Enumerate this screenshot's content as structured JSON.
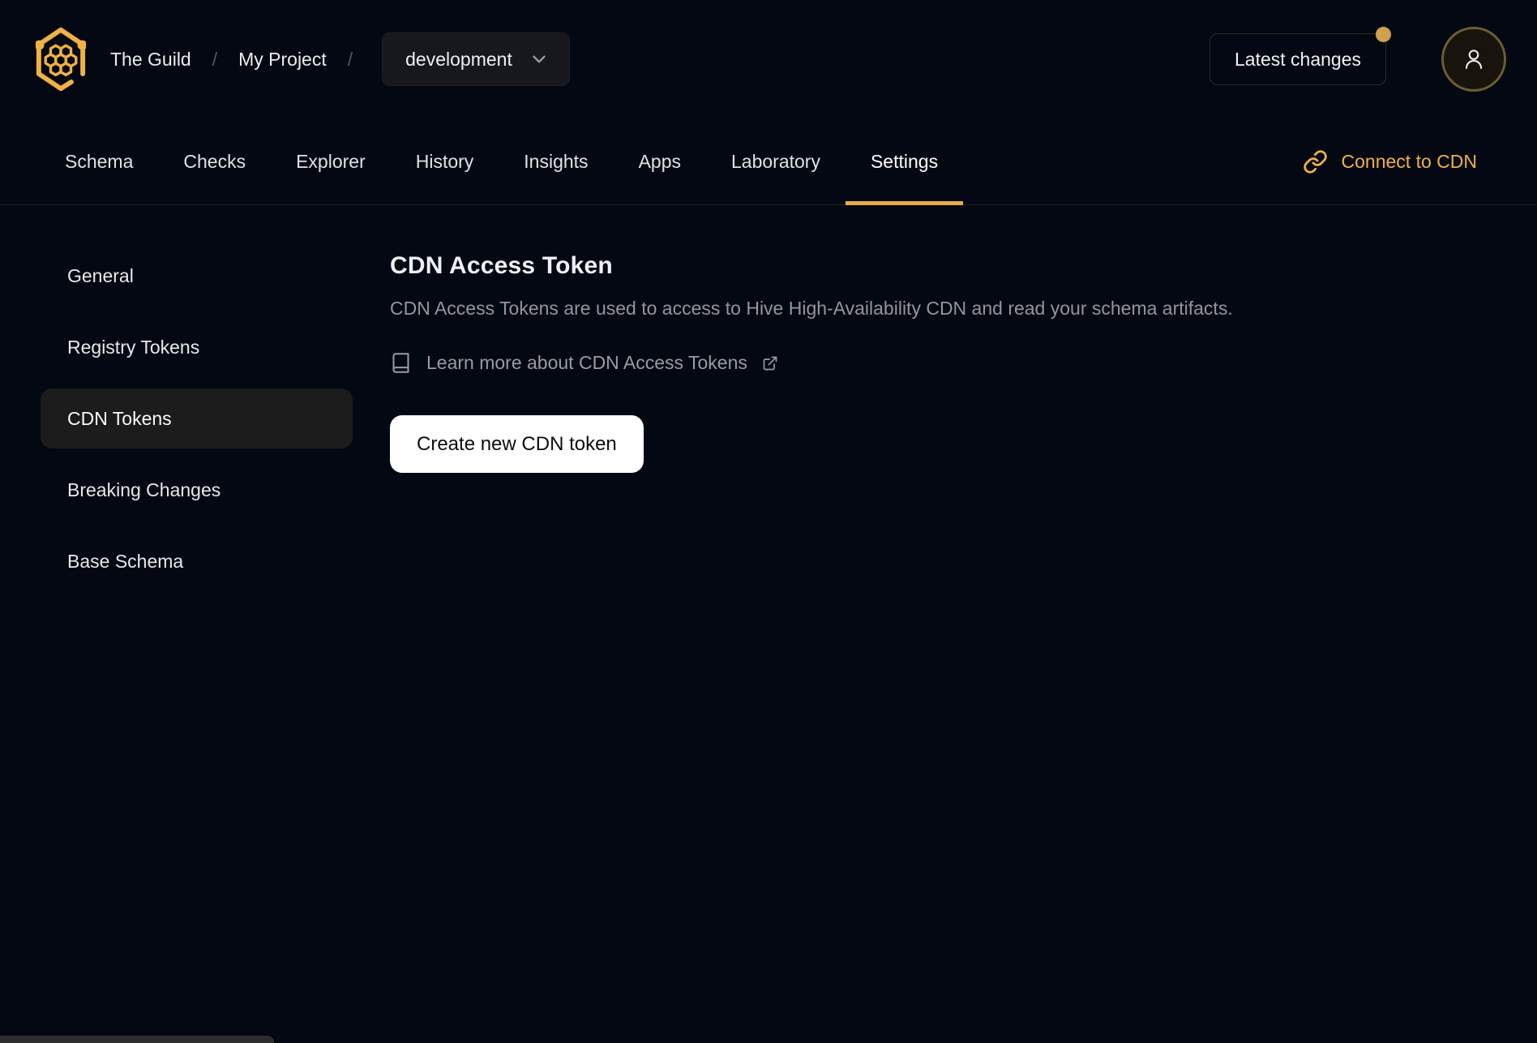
{
  "header": {
    "organization": "The Guild",
    "separator": "/",
    "project": "My Project",
    "target": "development",
    "latest_changes": "Latest changes",
    "notification_dot": true
  },
  "nav": {
    "tabs": [
      "Schema",
      "Checks",
      "Explorer",
      "History",
      "Insights",
      "Apps",
      "Laboratory",
      "Settings"
    ],
    "active_tab": "Settings",
    "connect_cdn": "Connect to CDN"
  },
  "sidebar": {
    "items": [
      "General",
      "Registry Tokens",
      "CDN Tokens",
      "Breaking Changes",
      "Base Schema"
    ],
    "active_item": "CDN Tokens"
  },
  "main": {
    "title": "CDN Access Token",
    "description": "CDN Access Tokens are used to access to Hive High-Availability CDN and read your schema artifacts.",
    "learn_more": "Learn more about CDN Access Tokens",
    "create_button": "Create new CDN token"
  },
  "icons": {
    "logo": "hive-honeycomb-logo",
    "avatar": "user-icon",
    "select": "chevron-down-icon",
    "connect": "link-chain-icon",
    "learn_more_left": "book-icon",
    "learn_more_right": "external-link-icon"
  },
  "colors": {
    "background": "#040812",
    "accent_gold": "#f0b14a",
    "tab_underline": "#e7ab4b",
    "notification_dot": "#cfa04e",
    "avatar_border": "#6e5c31",
    "active_sidebar_bg": "#1c1c1c",
    "muted_text": "#95959a",
    "button_bg": "#ffffff"
  }
}
